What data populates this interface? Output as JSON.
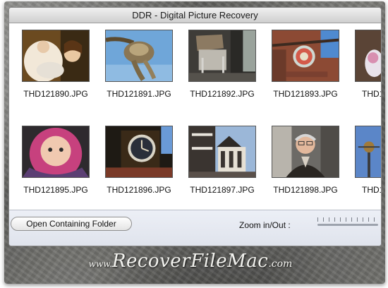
{
  "window": {
    "title": "DDR - Digital Picture Recovery"
  },
  "thumbnails": [
    {
      "filename": "THD121890.JPG",
      "icon": "mother-child-photo"
    },
    {
      "filename": "THD121891.JPG",
      "icon": "rope-knot-photo"
    },
    {
      "filename": "THD121892.JPG",
      "icon": "stone-bench-photo"
    },
    {
      "filename": "THD121893.JPG",
      "icon": "wall-clock-sign-photo"
    },
    {
      "filename": "THD1",
      "icon": "partial-photo"
    },
    {
      "filename": "THD121895.JPG",
      "icon": "baby-hood-photo"
    },
    {
      "filename": "THD121896.JPG",
      "icon": "clock-tower-photo"
    },
    {
      "filename": "THD121897.JPG",
      "icon": "tudor-street-photo"
    },
    {
      "filename": "THD121898.JPG",
      "icon": "old-man-photo"
    },
    {
      "filename": "THD1",
      "icon": "partial-photo"
    }
  ],
  "footer": {
    "open_folder_label": "Open Containing Folder",
    "zoom_label": "Zoom in/Out :"
  },
  "brand": {
    "prefix": "www.",
    "name": "RecoverFileMac",
    "suffix": ".com"
  }
}
